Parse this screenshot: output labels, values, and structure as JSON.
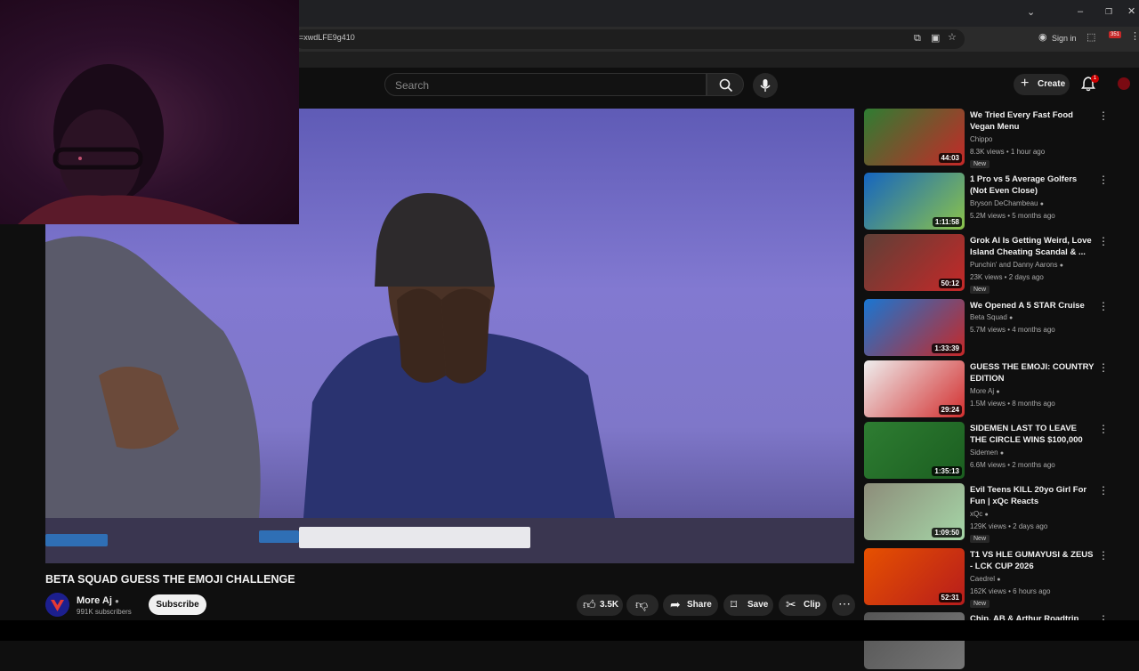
{
  "browser": {
    "url_fragment": "=xwdLFE9g410",
    "sign_in": "Sign in",
    "ext_badge": "351"
  },
  "header": {
    "search_placeholder": "Search",
    "create_label": "Create",
    "bell_badge": "1"
  },
  "video": {
    "title": "BETA SQUAD GUESS THE EMOJI CHALLENGE",
    "channel": "More Aj",
    "subscribers": "991K subscribers",
    "subscribe_label": "Subscribe",
    "likes": "3.5K",
    "share_label": "Share",
    "save_label": "Save",
    "clip_label": "Clip"
  },
  "recommendations": [
    {
      "title": "We Tried Every Fast Food Vegan Menu",
      "channel": "Chippo",
      "verified": false,
      "meta": "8.3K views • 1 hour ago",
      "badge": "New",
      "duration": "44:03",
      "color1": "#2e7d32",
      "color2": "#c62828"
    },
    {
      "title": "1 Pro vs 5 Average Golfers (Not Even Close)",
      "channel": "Bryson DeChambeau",
      "verified": true,
      "meta": "5.2M views • 5 months ago",
      "badge": "",
      "duration": "1:11:58",
      "color1": "#1565c0",
      "color2": "#8bc34a"
    },
    {
      "title": "Grok AI Is Getting Weird, Love Island Cheating Scandal & ...",
      "channel": "Punchin' and Danny Aarons",
      "verified": true,
      "meta": "23K views • 2 days ago",
      "badge": "New",
      "duration": "50:12",
      "color1": "#5d4037",
      "color2": "#c62828"
    },
    {
      "title": "We Opened A 5 STAR Cruise",
      "channel": "Beta Squad",
      "verified": true,
      "meta": "5.7M views • 4 months ago",
      "badge": "",
      "duration": "1:33:39",
      "color1": "#1976d2",
      "color2": "#c62828"
    },
    {
      "title": "GUESS THE EMOJI: COUNTRY EDITION",
      "channel": "More Aj",
      "verified": true,
      "meta": "1.5M views • 8 months ago",
      "badge": "",
      "duration": "29:24",
      "color1": "#eeeeee",
      "color2": "#d32f2f"
    },
    {
      "title": "SIDEMEN LAST TO LEAVE THE CIRCLE WINS $100,000",
      "channel": "Sidemen",
      "verified": true,
      "meta": "6.6M views • 2 months ago",
      "badge": "",
      "duration": "1:35:13",
      "color1": "#2e7d32",
      "color2": "#1b5e20"
    },
    {
      "title": "Evil Teens KILL 20yo Girl For Fun | xQc Reacts",
      "channel": "xQc",
      "verified": true,
      "meta": "129K views • 2 days ago",
      "badge": "New",
      "duration": "1:09:50",
      "color1": "#8d8d7a",
      "color2": "#a5d6a7"
    },
    {
      "title": "T1 VS HLE GUMAYUSI & ZEUS - LCK CUP 2026",
      "channel": "Caedrel",
      "verified": true,
      "meta": "162K views • 6 hours ago",
      "badge": "New",
      "duration": "52:31",
      "color1": "#e65100",
      "color2": "#b71c1c"
    },
    {
      "title": "Chip, AB & Arthur Roadtrip",
      "channel": "",
      "verified": false,
      "meta": "",
      "badge": "",
      "duration": "",
      "color1": "#555555",
      "color2": "#777777"
    }
  ]
}
